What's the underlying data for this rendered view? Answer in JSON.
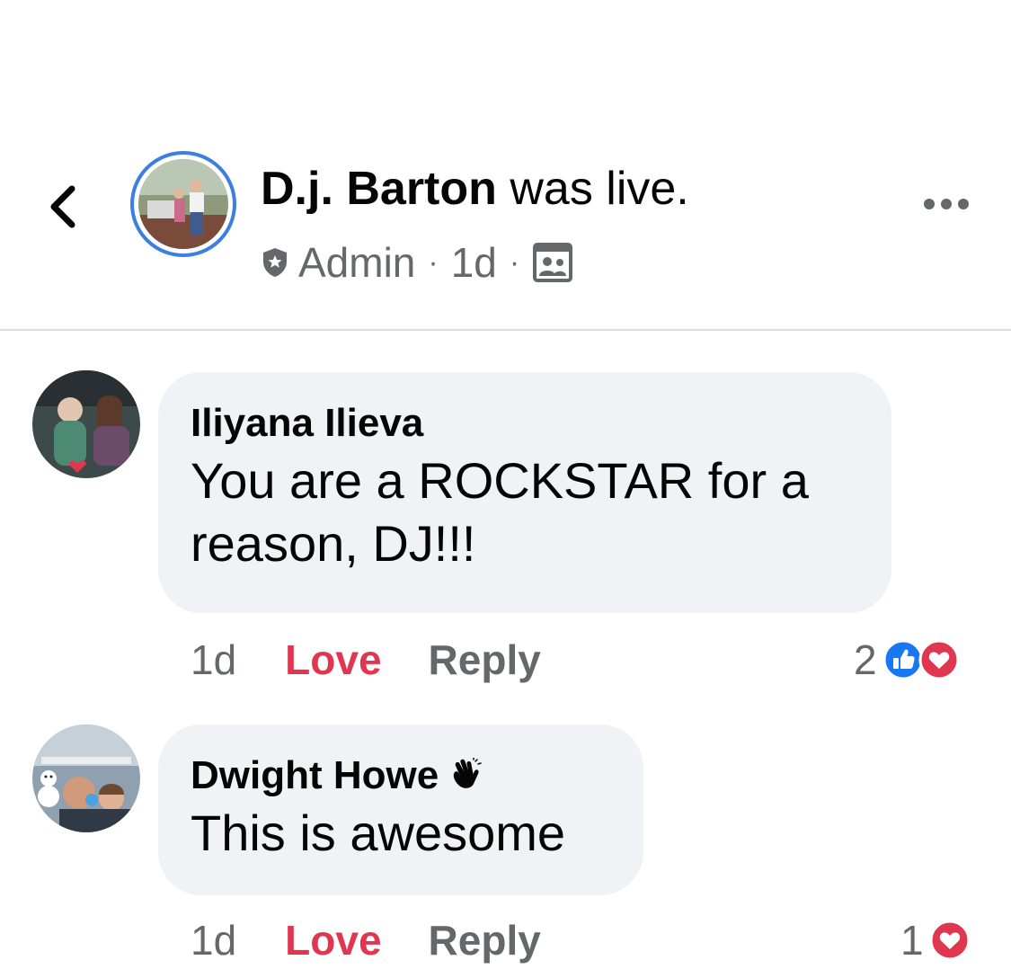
{
  "post": {
    "author": "D.j. Barton",
    "action": "was live.",
    "role": "Admin",
    "time": "1d",
    "separator": "·"
  },
  "icons": {
    "back": "chevron-left-icon",
    "more": "more-dots-icon",
    "admin": "shield-icon",
    "audience": "group-audience-icon",
    "like": "like-reaction-icon",
    "love": "love-reaction-icon",
    "wave": "wave-hand-icon"
  },
  "comments": [
    {
      "author": "Iliyana Ilieva",
      "text_line1": "You are a ROCKSTAR for a",
      "text_line2": "reason, DJ!!!",
      "time": "1d",
      "love_label": "Love",
      "reply_label": "Reply",
      "reaction_count": "2"
    },
    {
      "author": "Dwight Howe",
      "text": "This is awesome",
      "time": "1d",
      "love_label": "Love",
      "reply_label": "Reply",
      "reaction_count": "1"
    }
  ],
  "colors": {
    "love": "#e0364f",
    "like": "#1877f2",
    "secondary_text": "#65676b",
    "bubble": "#f0f2f5",
    "avatar_ring": "#3b7fe0"
  }
}
